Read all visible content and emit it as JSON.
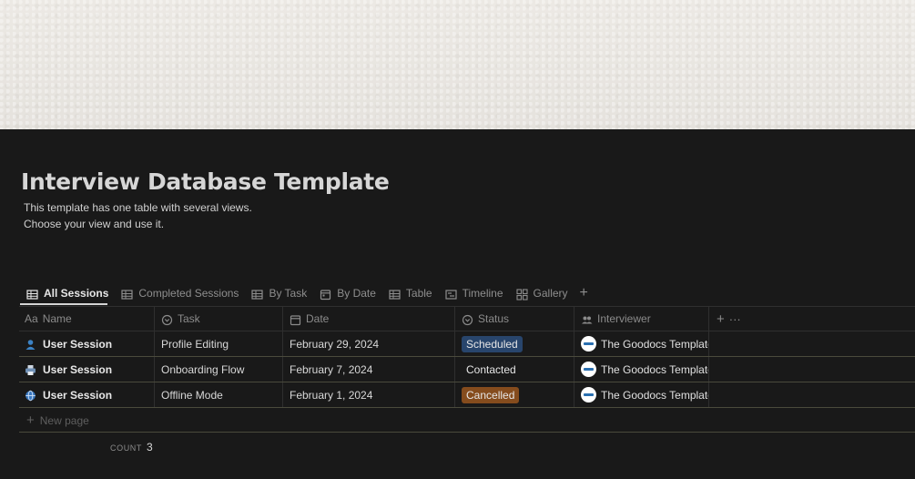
{
  "page": {
    "title": "Interview Database Template",
    "description_line1": "This template has one table with several views.",
    "description_line2": "Choose your view and use it."
  },
  "tabs": [
    {
      "label": "All Sessions",
      "icon": "table-icon",
      "active": true
    },
    {
      "label": "Completed Sessions",
      "icon": "table-icon"
    },
    {
      "label": "By Task",
      "icon": "table-icon"
    },
    {
      "label": "By Date",
      "icon": "calendar-icon"
    },
    {
      "label": "Table",
      "icon": "table-icon"
    },
    {
      "label": "Timeline",
      "icon": "timeline-icon"
    },
    {
      "label": "Gallery",
      "icon": "gallery-icon"
    }
  ],
  "add_view": "+",
  "columns": [
    {
      "label": "Name",
      "prefix": "Aa"
    },
    {
      "label": "Task",
      "icon": "select-icon"
    },
    {
      "label": "Date",
      "icon": "calendar-icon"
    },
    {
      "label": "Status",
      "icon": "status-icon"
    },
    {
      "label": "Interviewer",
      "icon": "people-icon"
    }
  ],
  "column_actions": {
    "add": "+",
    "more": "···"
  },
  "rows": [
    {
      "icon": "user-icon",
      "name": "User Session",
      "task": "Profile Editing",
      "date": "February 29, 2024",
      "status": "Scheduled",
      "interviewer": "The Goodocs Template"
    },
    {
      "icon": "printer-icon",
      "name": "User Session",
      "task": "Onboarding Flow",
      "date": "February 7, 2024",
      "status": "Contacted",
      "interviewer": "The Goodocs Template"
    },
    {
      "icon": "globe-icon",
      "name": "User Session",
      "task": "Offline Mode",
      "date": "February 1, 2024",
      "status": "Cancelled",
      "interviewer": "The Goodocs Template"
    }
  ],
  "status_colors": {
    "Scheduled": "#28456c",
    "Contacted": "transparent",
    "Cancelled": "#854c1d"
  },
  "new_page": "New page",
  "count": {
    "label": "COUNT",
    "value": "3"
  }
}
